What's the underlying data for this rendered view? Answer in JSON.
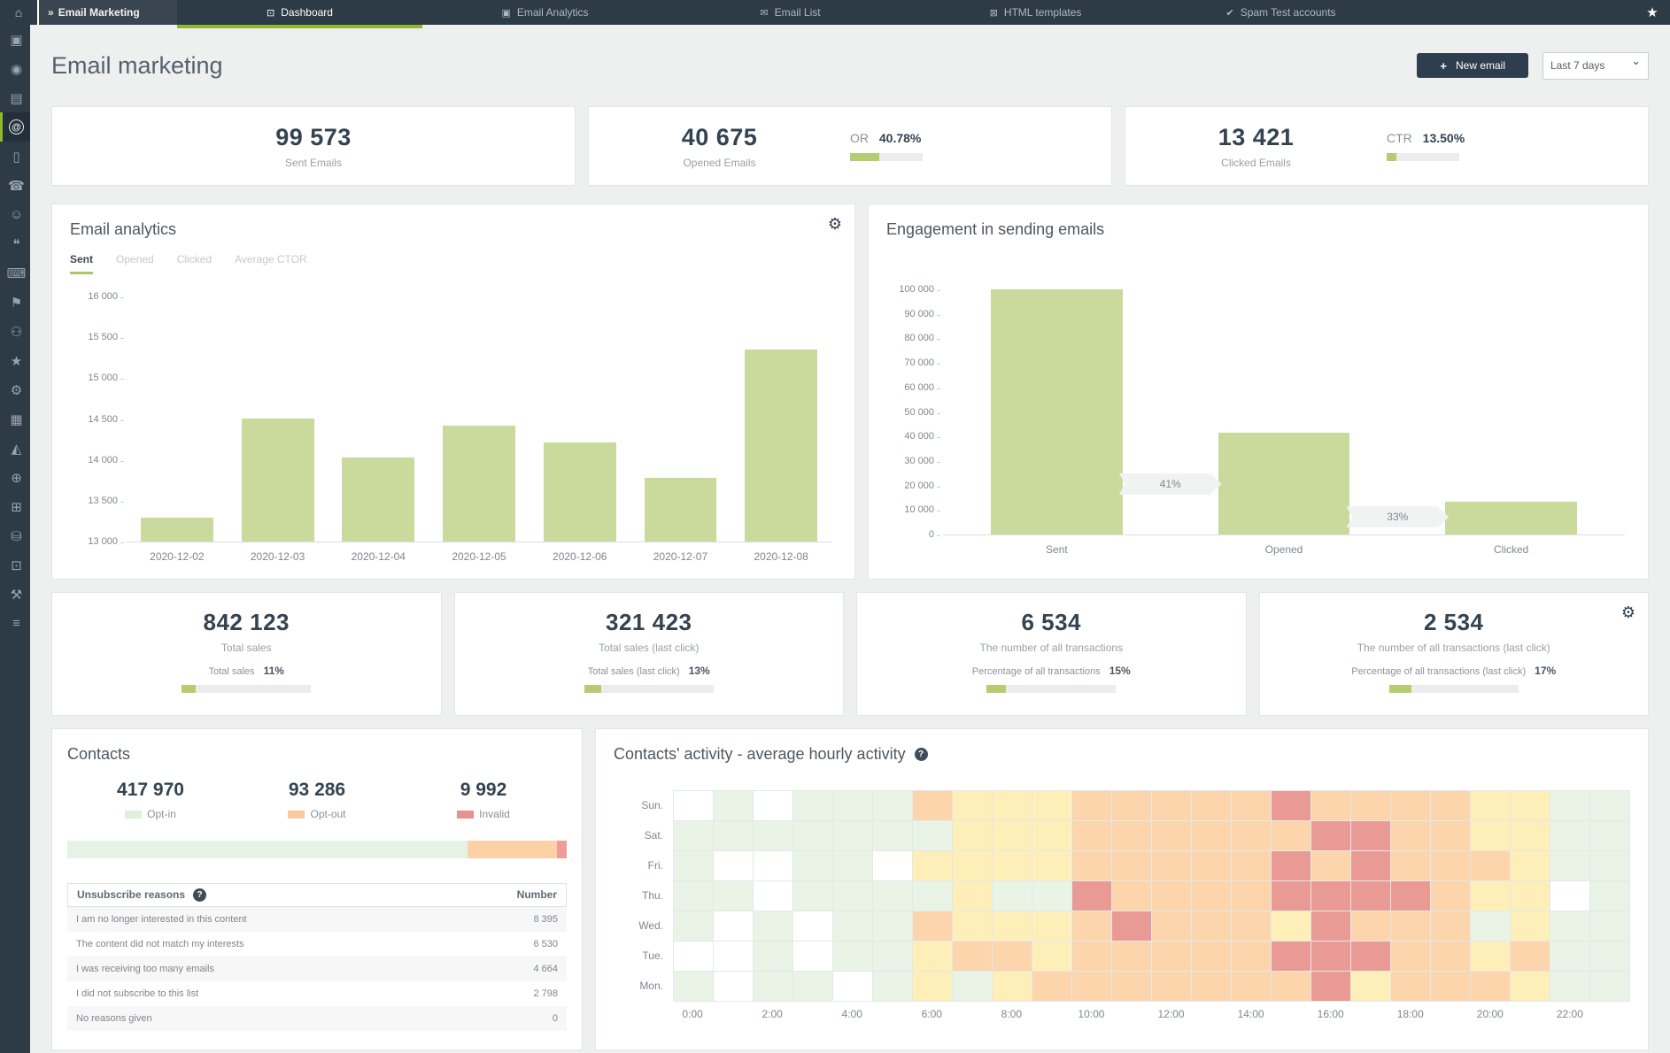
{
  "navbar": {
    "home_icon": "⌂",
    "brand_icon": "»",
    "brand_label": "Email Marketing",
    "tabs": [
      {
        "label": "Dashboard",
        "icon": "⊡",
        "icon_name": "dashboard-icon",
        "active": true
      },
      {
        "label": "Email Analytics",
        "icon": "▣",
        "icon_name": "email-analytics-icon",
        "active": false
      },
      {
        "label": "Email List",
        "icon": "✉",
        "icon_name": "email-list-icon",
        "active": false
      },
      {
        "label": "HTML templates",
        "icon": "⊠",
        "icon_name": "html-templates-icon",
        "active": false
      },
      {
        "label": "Spam Test accounts",
        "icon": "✔",
        "icon_name": "spam-test-icon",
        "active": false
      }
    ],
    "favorite_icon": "★"
  },
  "sidebar": {
    "items": [
      {
        "name": "pages-icon",
        "glyph": "▣",
        "active": false
      },
      {
        "name": "preview-eye-icon",
        "glyph": "◉",
        "active": false
      },
      {
        "name": "contact-card-icon",
        "glyph": "▤",
        "active": false
      },
      {
        "name": "email-marketing-at-icon",
        "glyph": "@",
        "active": true
      },
      {
        "name": "mobile-icon",
        "glyph": "▯",
        "active": false
      },
      {
        "name": "phone-icon",
        "glyph": "☎",
        "active": false
      },
      {
        "name": "add-contact-icon",
        "glyph": "☺",
        "active": false
      },
      {
        "name": "chat-icon",
        "glyph": "❝",
        "active": false
      },
      {
        "name": "laptop-icon",
        "glyph": "⌨",
        "active": false
      },
      {
        "name": "campaigns-megaphone-icon",
        "glyph": "⚑",
        "active": false
      },
      {
        "name": "audience-users-icon",
        "glyph": "⚇",
        "active": false
      },
      {
        "name": "loyalty-star-icon",
        "glyph": "★",
        "active": false
      },
      {
        "name": "automation-gears-icon",
        "glyph": "⚙",
        "active": false
      },
      {
        "name": "apps-grid-icon",
        "glyph": "▦",
        "active": false
      },
      {
        "name": "analytics-chart-icon",
        "glyph": "◭",
        "active": false
      },
      {
        "name": "integrations-globe-icon",
        "glyph": "⊕",
        "active": false
      },
      {
        "name": "calendar-icon",
        "glyph": "⊞",
        "active": false
      },
      {
        "name": "database-icon",
        "glyph": "⛁",
        "active": false
      },
      {
        "name": "documents-icon",
        "glyph": "⊡",
        "active": false
      },
      {
        "name": "tools-wrench-icon",
        "glyph": "⚒",
        "active": false
      },
      {
        "name": "settings-sliders-icon",
        "glyph": "≡",
        "active": false
      }
    ]
  },
  "header": {
    "title": "Email marketing",
    "plus_icon": "+",
    "new_email_label": "New email",
    "date_range_value": "Last 7 days"
  },
  "summary_cards": {
    "sent": {
      "value": "99 573",
      "label": "Sent Emails"
    },
    "opened": {
      "value": "40 675",
      "label": "Opened Emails",
      "rate_label": "OR",
      "rate": "40.78%",
      "rate_pct": 40.78
    },
    "clicked": {
      "value": "13 421",
      "label": "Clicked Emails",
      "rate_label": "CTR",
      "rate": "13.50%",
      "rate_pct": 13.5
    }
  },
  "chart_data": [
    {
      "type": "bar",
      "title": "Email analytics",
      "tabs": [
        "Sent",
        "Opened",
        "Clicked",
        "Average CTOR"
      ],
      "active_tab": "Sent",
      "categories": [
        "2020-12-02",
        "2020-12-03",
        "2020-12-04",
        "2020-12-05",
        "2020-12-06",
        "2020-12-07",
        "2020-12-08"
      ],
      "values": [
        13290,
        14510,
        14030,
        14420,
        14210,
        13780,
        15350
      ],
      "ylim": [
        13000,
        16000
      ],
      "yticks": [
        "16 000",
        "15 500",
        "15 000",
        "14 500",
        "14 000",
        "13 500",
        "13 000"
      ],
      "bar_color": "#cada9c",
      "grid": false,
      "legend_position": "none"
    },
    {
      "type": "bar",
      "subtype": "funnel",
      "title": "Engagement in sending emails",
      "categories": [
        "Sent",
        "Opened",
        "Clicked"
      ],
      "values": [
        100500,
        41500,
        13500
      ],
      "ylim": [
        0,
        100000
      ],
      "yticks": [
        "100 000",
        "90 000",
        "80 000",
        "70 000",
        "60 000",
        "50 000",
        "40 000",
        "30 000",
        "20 000",
        "10 000",
        "0"
      ],
      "bar_color": "#cada9c",
      "arrows": [
        {
          "between": [
            "Sent",
            "Opened"
          ],
          "label": "41%",
          "level": 21000
        },
        {
          "between": [
            "Opened",
            "Clicked"
          ],
          "label": "33%",
          "level": 7500
        }
      ],
      "grid": false
    },
    {
      "type": "heatmap",
      "title": "Contacts' activity - average hourly activity",
      "rows": [
        "Sun.",
        "Sat.",
        "Fri.",
        "Thu.",
        "Wed.",
        "Tue.",
        "Mon."
      ],
      "col_labels": [
        "0:00",
        "2:00",
        "4:00",
        "6:00",
        "8:00",
        "10:00",
        "12:00",
        "14:00",
        "16:00",
        "18:00",
        "20:00",
        "22:00"
      ],
      "matrix": [
        "WGWGGGOYYYOOOOOROOOOYYGG",
        "GGGGGGGYYYOOOOOORROOYYGG",
        "GWWGGWYYYYOOOOOROROOOYGG",
        "GGWGGGGYGGROOOORRRROYYWG",
        "GWGWGGOYYYOROOOYROOOGYGG",
        "WWGWGGYOOYOOOOORRROOYOGG",
        "GWGGWGYGYOOOOOOORYOOOYGG"
      ],
      "palette": {
        "W": "#ffffff",
        "G": "#e9f3e6",
        "Y": "#fdefb7",
        "O": "#fcd5ad",
        "R": "#ea9a94"
      },
      "scale_meaning": "white=none, green=low, yellow=medium, orange=high, red=peak"
    }
  ],
  "sales_cards": [
    {
      "value": "842 123",
      "label": "Total sales",
      "pct_label": "Total sales",
      "pct": "11%",
      "pct_value": 11,
      "gear": false
    },
    {
      "value": "321 423",
      "label": "Total sales (last click)",
      "pct_label": "Total sales (last click)",
      "pct": "13%",
      "pct_value": 13,
      "gear": false
    },
    {
      "value": "6 534",
      "label": "The number of all transactions",
      "pct_label": "Percentage of all transactions",
      "pct": "15%",
      "pct_value": 15,
      "gear": false
    },
    {
      "value": "2 534",
      "label": "The number of all transactions (last click)",
      "pct_label": "Percentage of all transactions (last click)",
      "pct": "17%",
      "pct_value": 17,
      "gear": true
    }
  ],
  "contacts": {
    "title": "Contacts",
    "stats": [
      {
        "value": "417 970",
        "label": "Opt-in",
        "swatch_color": "#dff0d8"
      },
      {
        "value": "93 286",
        "label": "Opt-out",
        "swatch_color": "#fbc99c"
      },
      {
        "value": "9 992",
        "label": "Invalid",
        "swatch_color": "#e88f8f"
      }
    ],
    "bar_segments": [
      {
        "pct": 80.2,
        "color": "#e7f2e6"
      },
      {
        "pct": 17.9,
        "color": "#fdd1a6"
      },
      {
        "pct": 1.9,
        "color": "#ee9c9a"
      }
    ],
    "table": {
      "header_reason": "Unsubscribe reasons",
      "help_icon": "?",
      "header_number": "Number",
      "rows": [
        {
          "reason": "I am no longer interested in this content",
          "number": "8 395"
        },
        {
          "reason": "The content did not match my interests",
          "number": "6 530"
        },
        {
          "reason": "I was receiving too many emails",
          "number": "4 664"
        },
        {
          "reason": "I did not subscribe to this list",
          "number": "2 798"
        },
        {
          "reason": "No reasons given",
          "number": "0"
        }
      ]
    }
  },
  "misc": {
    "gear_icon": "⚙",
    "help_icon": "?"
  },
  "colors": {
    "accent_green": "#8fb92d",
    "bar_green": "#cada9c",
    "progress_green": "#b7cb70",
    "navbar_bg": "#2d3b47",
    "number_color": "#344351"
  }
}
